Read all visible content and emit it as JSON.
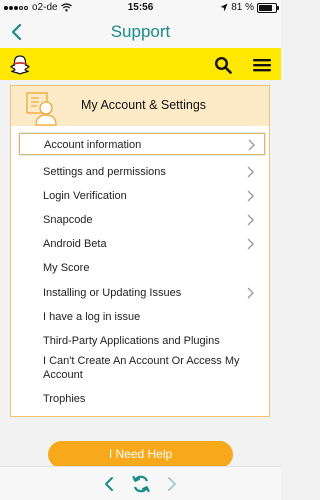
{
  "status_bar": {
    "carrier": "o2-de",
    "time": "15:56",
    "battery": "81 %",
    "battery_level": 0.81
  },
  "nav": {
    "title": "Support"
  },
  "header": {
    "logo": "ghost-icon",
    "search_icon": "search-icon",
    "menu_icon": "menu-icon"
  },
  "card": {
    "title": "My Account & Settings",
    "icon": "account-settings-icon",
    "items": [
      {
        "label": "Account information",
        "chevron": true,
        "selected": true
      },
      {
        "label": "Settings and permissions",
        "chevron": true
      },
      {
        "label": "Login Verification",
        "chevron": true
      },
      {
        "label": "Snapcode",
        "chevron": true
      },
      {
        "label": "Android Beta",
        "chevron": true
      },
      {
        "label": "My Score",
        "chevron": false
      },
      {
        "label": "Installing or Updating Issues",
        "chevron": true
      },
      {
        "label": "I have a log in issue",
        "chevron": false
      },
      {
        "label": "Third-Party Applications and Plugins",
        "chevron": false
      },
      {
        "label": "I Can't Create An Account Or Access My Account",
        "chevron": false
      },
      {
        "label": "Trophies",
        "chevron": false
      }
    ]
  },
  "cta": {
    "label": "I Need Help"
  },
  "colors": {
    "accent_teal": "#1a8a8a",
    "header_yellow": "#ffe800",
    "cta_orange": "#f7a81b",
    "card_border": "#f2c27a"
  }
}
